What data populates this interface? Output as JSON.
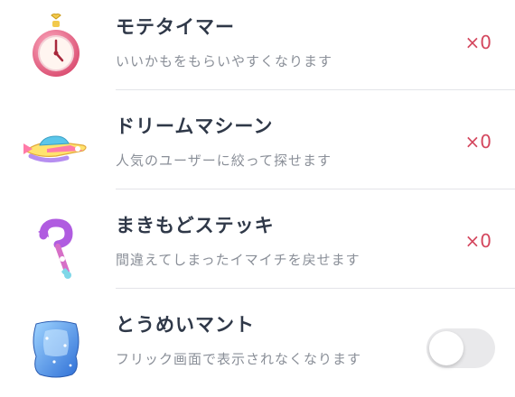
{
  "items": [
    {
      "title": "モテタイマー",
      "description": "いいかもをもらいやすくなります",
      "count": "×0",
      "icon": "stopwatch-icon"
    },
    {
      "title": "ドリームマシーン",
      "description": "人気のユーザーに絞って探せます",
      "count": "×0",
      "icon": "dream-machine-icon"
    },
    {
      "title": "まきもどステッキ",
      "description": "間違えてしまったイマイチを戻せます",
      "count": "×0",
      "icon": "rewind-wand-icon"
    },
    {
      "title": "とうめいマント",
      "description": "フリック画面で表示されなくなります",
      "toggle_on": false,
      "icon": "invisible-cloak-icon"
    }
  ],
  "colors": {
    "count": "#d4475e",
    "title": "#2f3848",
    "description": "#8a8f98",
    "toggle_off": "#e9e9eb"
  }
}
